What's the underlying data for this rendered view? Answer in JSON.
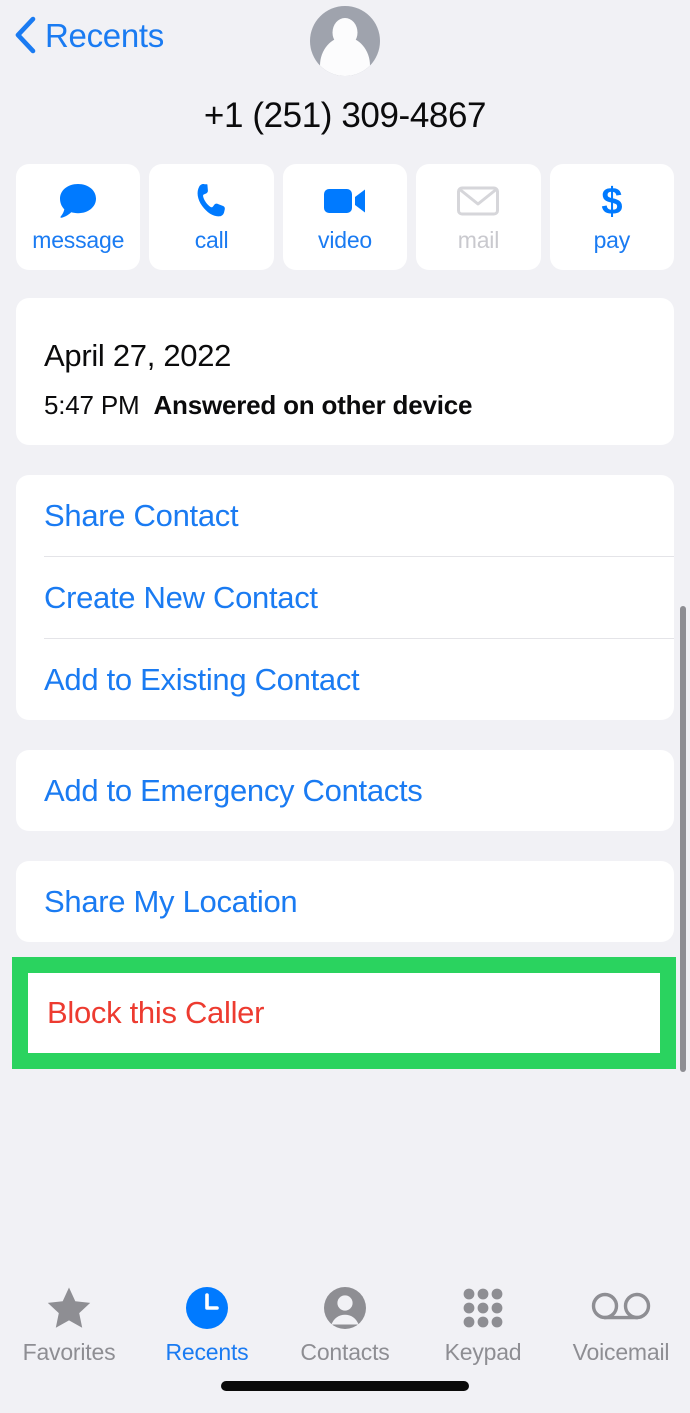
{
  "navbar": {
    "back_label": "Recents",
    "back_icon": "chevron-left-icon"
  },
  "header": {
    "avatar_icon": "person-placeholder-avatar",
    "phone_number": "+1 (251) 309-4867"
  },
  "actions": [
    {
      "label": "message",
      "icon": "message-bubble-icon",
      "enabled": true
    },
    {
      "label": "call",
      "icon": "phone-handset-icon",
      "enabled": true
    },
    {
      "label": "video",
      "icon": "video-camera-icon",
      "enabled": true
    },
    {
      "label": "mail",
      "icon": "envelope-icon",
      "enabled": false
    },
    {
      "label": "pay",
      "icon": "dollar-sign-icon",
      "enabled": true
    }
  ],
  "call_record": {
    "date": "April 27, 2022",
    "time": "5:47 PM",
    "status": "Answered on other device"
  },
  "menu_group_1": [
    {
      "label": "Share Contact"
    },
    {
      "label": "Create New Contact"
    },
    {
      "label": "Add to Existing Contact"
    }
  ],
  "menu_group_2": [
    {
      "label": "Add to Emergency Contacts"
    }
  ],
  "menu_group_3": [
    {
      "label": "Share My Location"
    }
  ],
  "block": {
    "label": "Block this Caller",
    "highlighted": true
  },
  "tabs": [
    {
      "label": "Favorites",
      "icon": "star-icon",
      "active": false
    },
    {
      "label": "Recents",
      "icon": "clock-icon",
      "active": true
    },
    {
      "label": "Contacts",
      "icon": "person-circle-icon",
      "active": false
    },
    {
      "label": "Keypad",
      "icon": "keypad-grid-icon",
      "active": false
    },
    {
      "label": "Voicemail",
      "icon": "voicemail-tape-icon",
      "active": false
    }
  ],
  "colors": {
    "accent_blue": "#1a7bf2",
    "destructive_red": "#ed3b30",
    "highlight_green": "#2ad35f",
    "inactive_grey": "#8e8e93",
    "background": "#f1f1f5",
    "card": "#ffffff"
  }
}
